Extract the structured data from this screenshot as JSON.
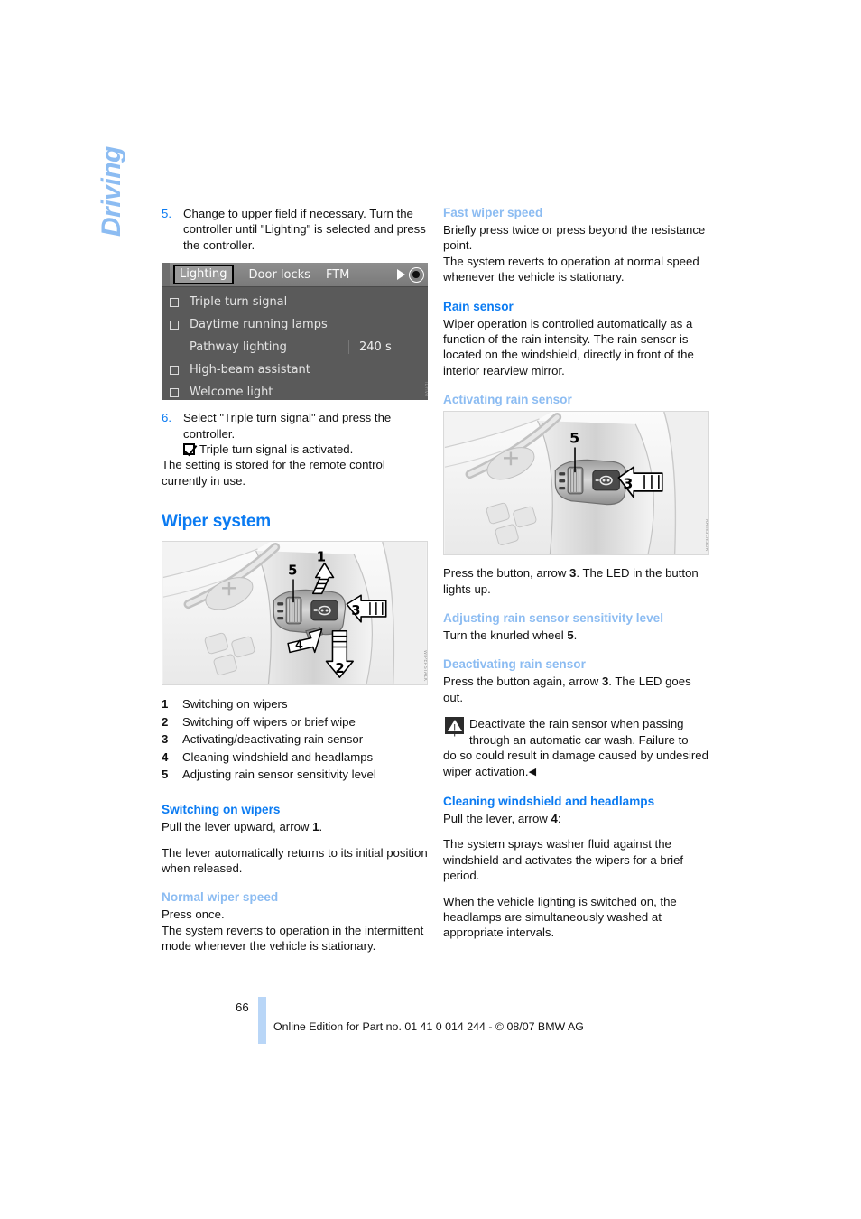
{
  "chapter": {
    "label": "Driving"
  },
  "page": {
    "number": "66",
    "footer": "Online Edition for Part no. 01 41 0 014 244 - © 08/07 BMW AG"
  },
  "left_column": {
    "steps": [
      {
        "num": "5.",
        "text": "Change to upper field if necessary. Turn the controller until \"Lighting\" is selected and press the controller."
      }
    ],
    "idrive": {
      "tabs": [
        {
          "label": "Lighting",
          "selected": true
        },
        {
          "label": "Door locks",
          "selected": false
        },
        {
          "label": "FTM",
          "selected": false
        }
      ],
      "rows": [
        {
          "checkbox": true,
          "label": "Triple turn signal",
          "value": ""
        },
        {
          "checkbox": true,
          "label": "Daytime running lamps",
          "value": ""
        },
        {
          "checkbox": false,
          "label": "Pathway lighting",
          "value": "240 s"
        },
        {
          "checkbox": true,
          "label": "High-beam assistant",
          "value": ""
        },
        {
          "checkbox": true,
          "label": "Welcome light",
          "value": ""
        }
      ]
    },
    "step6": {
      "num": "6.",
      "text": "Select \"Triple turn signal\" and press the controller."
    },
    "step6_result": "Triple turn signal is activated.",
    "step_note": "The setting is stored for the remote control currently in use.",
    "section_title": "Wiper system",
    "figure_labels": {
      "one": "1",
      "two": "2",
      "three": "3",
      "four": "4",
      "five": "5"
    },
    "legend": [
      {
        "num": "1",
        "label": "Switching on wipers"
      },
      {
        "num": "2",
        "label": "Switching off wipers or brief wipe"
      },
      {
        "num": "3",
        "label": "Activating/deactivating rain sensor"
      },
      {
        "num": "4",
        "label": "Cleaning windshield and headlamps"
      },
      {
        "num": "5",
        "label": "Adjusting rain sensor sensitivity level"
      }
    ],
    "switching_on": {
      "heading": "Switching on wipers",
      "para1_a": "Pull the lever upward, arrow ",
      "para1_n": "1",
      "para1_b": ".",
      "para2": "The lever automatically returns to its initial position when released."
    },
    "normal_speed": {
      "heading": "Normal wiper speed",
      "para1": "Press once.",
      "para2": "The system reverts to operation in the intermittent mode whenever the vehicle is stationary."
    }
  },
  "right_column": {
    "fast_speed": {
      "heading": "Fast wiper speed",
      "para1": "Briefly press twice or press beyond the resistance point.",
      "para2": "The system reverts to operation at normal speed whenever the vehicle is stationary."
    },
    "rain_sensor": {
      "heading": "Rain sensor",
      "para1": "Wiper operation is controlled automatically as a function of the rain intensity. The rain sensor is located on the windshield, directly in front of the interior rearview mirror."
    },
    "activating": {
      "heading": "Activating rain sensor",
      "figure_labels": {
        "three": "3",
        "five": "5"
      },
      "para_a": "Press the button, arrow ",
      "para_n": "3",
      "para_b": ". The LED in the button lights up."
    },
    "adjusting": {
      "heading": "Adjusting rain sensor sensitivity level",
      "para_a": "Turn the knurled wheel ",
      "para_n": "5",
      "para_b": "."
    },
    "deactivating": {
      "heading": "Deactivating rain sensor",
      "para_a": "Press the button again, arrow ",
      "para_n": "3",
      "para_b": ". The LED goes out.",
      "warning_a": "Deactivate the rain sensor when passing through an automatic car wash. Failure to",
      "warning_b": "do so could result in damage caused by undesired wiper activation.",
      "warning_end": "◀"
    },
    "cleaning": {
      "heading": "Cleaning windshield and headlamps",
      "para1_a": "Pull the lever, arrow ",
      "para1_n": "4",
      "para1_b": ":",
      "para2": "The system sprays washer fluid against the windshield and activates the wipers for a brief period.",
      "para3": "When the vehicle lighting is switched on, the headlamps are simultaneously washed at appropriate intervals."
    }
  }
}
